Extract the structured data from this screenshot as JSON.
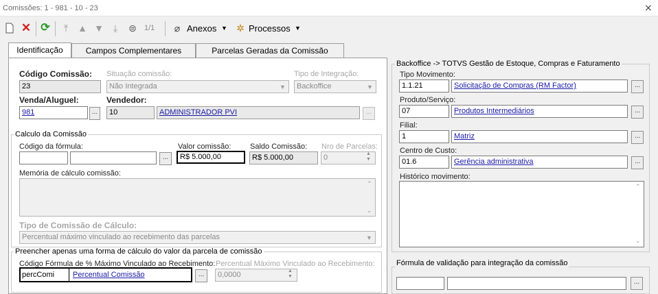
{
  "window": {
    "title": "Comissões: 1 - 981 - 10 - 23"
  },
  "toolbar": {
    "record_position": "1/1",
    "attachments_label": "Anexos",
    "processes_label": "Processos"
  },
  "tabs": [
    {
      "label": "Identificação",
      "active": true
    },
    {
      "label": "Campos Complementares",
      "active": false
    },
    {
      "label": "Parcelas Geradas da Comissão",
      "active": false
    }
  ],
  "identification": {
    "codigo_label": "Código Comissão:",
    "codigo_value": "23",
    "situacao_label": "Situação comissão:",
    "situacao_value": "Não Integrada",
    "integracao_label": "Tipo de Integração:",
    "integracao_value": "Backoffice",
    "venda_label": "Venda/Aluguel:",
    "venda_value": "981",
    "vendedor_label": "Vendedor:",
    "vendedor_code": "10",
    "vendedor_name": "ADMINISTRADOR PVI"
  },
  "calc": {
    "group_title": "Calculo da Comissão",
    "formula_label": "Código da fórmula:",
    "formula_code": "",
    "formula_name": "",
    "valor_label": "Valor comissão:",
    "valor_value": "R$ 5.000,00",
    "saldo_label": "Saldo Comissão:",
    "saldo_value": "R$ 5.000,00",
    "parcelas_label": "Nro de Parcelas:",
    "parcelas_value": "0",
    "memoria_label": "Memória de cálculo comissão:",
    "tipo_label": "Tipo de Comissão de Cálculo:",
    "tipo_value": "Percentual máximo vinculado ao recebimento das parcelas"
  },
  "parcela_rule": {
    "group_title": "Preencher apenas uma forma de cálculo do valor da parcela de comissão",
    "formula_label": "Código Fórmula de % Máximo Vinculado ao Recebimento:",
    "formula_code": "percComi",
    "formula_name": "Percentual Comissão",
    "percent_label": "Percentual Máximo Vinculado ao Recebimento:",
    "percent_value": "0,0000"
  },
  "backoffice": {
    "group_title": "Backoffice -> TOTVS Gestão de Estoque, Compras e Faturamento",
    "tipo_mov_label": "Tipo Movimento:",
    "tipo_mov_code": "1.1.21",
    "tipo_mov_name": "Solicitação de Compras (RM Factor)",
    "produto_label": "Produto/Serviço:",
    "produto_code": "07",
    "produto_name": "Produtos Intermediários",
    "filial_label": "Filial:",
    "filial_code": "1",
    "filial_name": "Matriz",
    "ccusto_label": "Centro de Custo:",
    "ccusto_code": "01.6",
    "ccusto_name": "Gerência administrativa",
    "historico_label": "Histórico movimento:"
  },
  "validation": {
    "group_title": "Fórmula de validação para integração da comissão",
    "code": "",
    "name": ""
  },
  "colors": {
    "link": "#1a1aa6",
    "delete_red": "#d42020",
    "refresh_green": "#2a9a2a"
  }
}
